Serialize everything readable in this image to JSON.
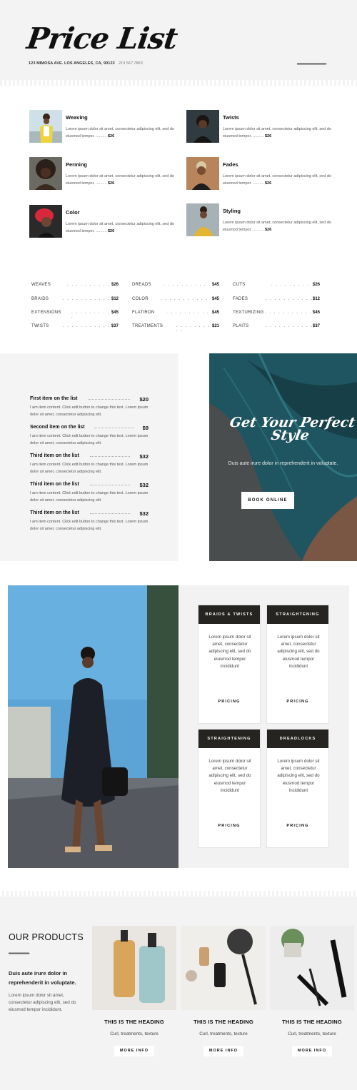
{
  "header": {
    "title": "Price List",
    "address": "123 MIMOSA AVE. LOS ANGELES, CA, 90123",
    "phone": "213 567 7863"
  },
  "services": [
    {
      "name": "Weaving",
      "desc": "Lorem ipsum dolor sit amet, consectetur adipiscing elit, sed do eiusmod tempor. ..........",
      "price": "$26"
    },
    {
      "name": "Twists",
      "desc": "Lorem ipsum dolor sit amet, consectetur adipiscing elit, sed do eiusmod tempor. ..........",
      "price": "$26"
    },
    {
      "name": "Perming",
      "desc": "Lorem ipsum dolor sit amet, consectetur adipiscing elit, sed do eiusmod tempor. ..........",
      "price": "$26"
    },
    {
      "name": "Fades",
      "desc": "Lorem ipsum dolor sit amet, consectetur adipiscing elit, sed do eiusmod tempor. ..........",
      "price": "$26"
    },
    {
      "name": "Color",
      "desc": "Lorem ipsum dolor sit amet, consectetur adipiscing elit, sed do eiusmod tempor. ..........",
      "price": "$26"
    },
    {
      "name": "Styling",
      "desc": "Lorem ipsum dolor sit amet, consectetur adipiscing elit, sed do eiusmod tempor. ..........",
      "price": "$26"
    }
  ],
  "price_grid": {
    "dots": ". . . . . . . . . . .",
    "col1": [
      {
        "label": "WEAVES",
        "price": "$26"
      },
      {
        "label": "BRAIDS",
        "price": "$12"
      },
      {
        "label": "EXTENSIONS",
        "price": "$45"
      },
      {
        "label": "TWISTS",
        "price": "$37"
      }
    ],
    "col2": [
      {
        "label": "DREADS",
        "price": "$45"
      },
      {
        "label": "COLOR",
        "price": "$45"
      },
      {
        "label": "FLATIRON",
        "price": "$45"
      },
      {
        "label": "TREATMENTS",
        "price": "$21"
      }
    ],
    "col3": [
      {
        "label": "CUTS",
        "price": "$26"
      },
      {
        "label": "FADES",
        "price": "$12"
      },
      {
        "label": "TEXTURIZING",
        "price": "$45"
      },
      {
        "label": "PLAITS",
        "price": "$37"
      }
    ]
  },
  "menu_items": [
    {
      "name": "First item on the list",
      "price": "$20",
      "desc": "I am item content. Click edit button to change this text. Lorem ipsum dolor sit amet, consectetur adipiscing elit."
    },
    {
      "name": "Second item on the list",
      "price": "$9",
      "desc": "I am item content. Click edit button to change this text. Lorem ipsum dolor sit amet, consectetur adipiscing elit."
    },
    {
      "name": "Third item on the list",
      "price": "$32",
      "desc": "I am item content. Click edit button to change this text. Lorem ipsum dolor sit amet, consectetur adipiscing elit."
    },
    {
      "name": "Third item on the list",
      "price": "$32",
      "desc": "I am item content. Click edit button to change this text. Lorem ipsum dolor sit amet, consectetur adipiscing elit."
    },
    {
      "name": "Third item on the list",
      "price": "$32",
      "desc": "I am item content. Click edit button to change this text. Lorem ipsum dolor sit amet, consectetur adipiscing elit."
    }
  ],
  "hero": {
    "title": "Get Your Perfect Style",
    "subtitle": "Duis aute irure dolor in reprehenderit in voluptate.",
    "button": "BOOK ONLINE"
  },
  "pricing_cards": [
    {
      "title": "BRAIDS & TWISTS",
      "text": "Lorem ipsum dolor sit amet, consectetur adipiscing elit, sed do eiusmod tempor incididunt",
      "link": "PRICING"
    },
    {
      "title": "STRAIGHTENING",
      "text": "Lorem ipsum dolor sit amet, consectetur adipiscing elit, sed do eiusmod tempor incididunt",
      "link": "PRICING"
    },
    {
      "title": "STRAIGHTENING",
      "text": "Lorem ipsum dolor sit amet, consectetur adipiscing elit, sed do eiusmod tempor incididunt",
      "link": "PRICING"
    },
    {
      "title": "DREADLOCKS",
      "text": "Lorem ipsum dolor sit amet, consectetur adipiscing elit, sed do eiusmod tempor incididunt",
      "link": "PRICING"
    }
  ],
  "products_section": {
    "heading": "OUR PRODUCTS",
    "lead": "Duis aute irure dolor in reprehenderit in voluptate.",
    "body": "Lorem ipsum dolor sit amet, consectetur adipiscing elit, sed do eiusmod tempor incididunt.",
    "items": [
      {
        "title": "THIS IS THE HEADING",
        "subtitle": "Curl, treatments, texture",
        "button": "MORE INFO"
      },
      {
        "title": "THIS IS THE HEADING",
        "subtitle": "Curl, treatments, texture",
        "button": "MORE INFO"
      },
      {
        "title": "THIS IS THE HEADING",
        "subtitle": "Curl, treatments, texture",
        "button": "MORE INFO"
      }
    ]
  },
  "colors": {
    "dark": "#262421",
    "panel": "#f4f4f4",
    "hero_hair": "#1f5560"
  }
}
